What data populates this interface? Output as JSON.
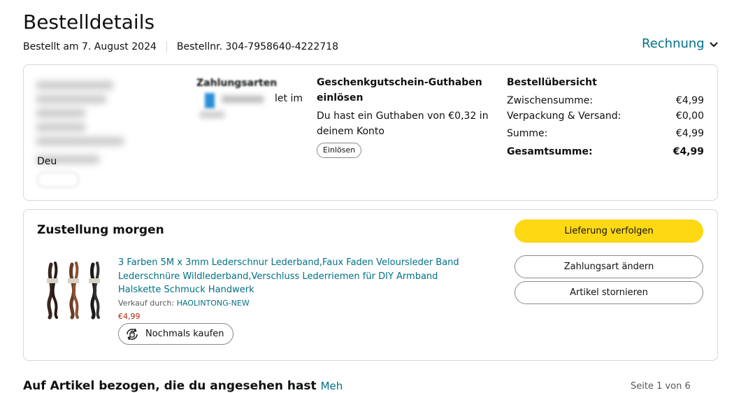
{
  "header": {
    "title": "Bestelldetails",
    "ordered_on": "Bestellt am 7. August 2024",
    "order_number": "Bestellnr. 304-7958640-4222718",
    "invoice_label": "Rechnung"
  },
  "shipping_address": {
    "country_fragment": "Deu"
  },
  "payment": {
    "heading": "Zahlungsarten",
    "visible_fragment": "let im"
  },
  "gift_card": {
    "heading_line1": "Geschenkgutschein-Guthaben",
    "heading_line2": "einlösen",
    "text_line1": "Du hast ein Guthaben von €0,32 in",
    "text_line2": "deinem Konto",
    "redeem_button": "Einlösen"
  },
  "summary": {
    "heading": "Bestellübersicht",
    "rows": [
      {
        "label": "Zwischensumme:",
        "value": "€4,99"
      },
      {
        "label": "Verpackung & Versand:",
        "value": "€0,00"
      },
      {
        "label": "Summe:",
        "value": "€4,99"
      },
      {
        "label": "Gesamtsumme:",
        "value": "€4,99"
      }
    ]
  },
  "delivery": {
    "title": "Zustellung morgen",
    "track_button": "Lieferung verfolgen",
    "change_payment_button": "Zahlungsart ändern",
    "cancel_button": "Artikel stornieren",
    "product": {
      "title": "3 Farben 5M x 3mm Lederschnur Lederband,Faux Faden Veloursleder Band Lederschnüre Wildlederband,Verschluss Lederriemen für DIY Armband Halskette Schmuck Handwerk",
      "sold_by_label": "Verkauf durch:",
      "seller": "HAOLINTONG-NEW",
      "price": "€4,99",
      "rebuy_button": "Nochmals kaufen"
    }
  },
  "related": {
    "heading": "Auf Artikel bezogen, die du angesehen hast",
    "more_link": "Meh",
    "page_indicator": "Seite 1 von 6"
  },
  "colors": {
    "link": "#007185",
    "primary_button": "#ffd814",
    "price": "#b12704",
    "border": "#d5d9d9"
  }
}
